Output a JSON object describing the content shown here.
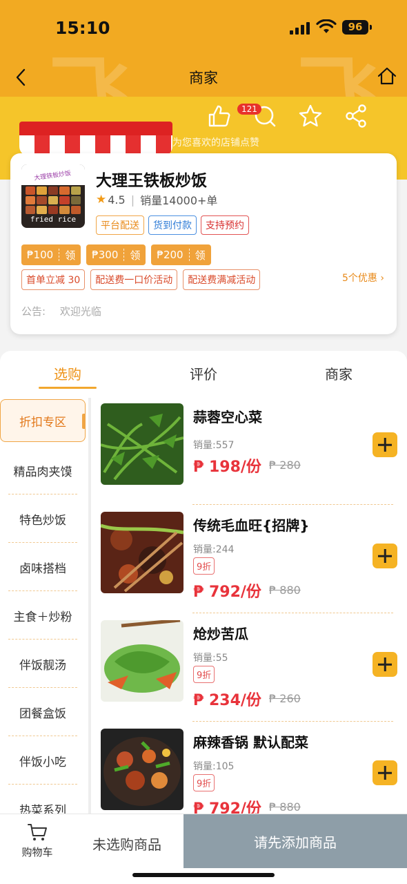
{
  "status_bar": {
    "time": "15:10",
    "battery": "96"
  },
  "nav": {
    "title": "商家"
  },
  "banner": {
    "like_count": "121",
    "tip": "为您喜欢的店铺点赞"
  },
  "shop": {
    "name": "大理王铁板炒饭",
    "logo_band": "大理铁板炒饭",
    "logo_text": "fried rice",
    "rating": "4.5",
    "sales": "销量14000+单",
    "tags": [
      {
        "label": "平台配送",
        "color": "orange"
      },
      {
        "label": "货到付款",
        "color": "blue"
      },
      {
        "label": "支持预约",
        "color": "red"
      }
    ],
    "coupons": [
      {
        "amount": "₱100",
        "action": "领"
      },
      {
        "amount": "₱300",
        "action": "领"
      },
      {
        "amount": "₱200",
        "action": "领"
      }
    ],
    "promos": [
      "首单立减 30",
      "配送费一口价活动",
      "配送费满减活动"
    ],
    "promo_more": "5个优惠",
    "notice_label": "公告:",
    "notice_text": "欢迎光临"
  },
  "tabs": [
    "选购",
    "评价",
    "商家"
  ],
  "active_tab": 0,
  "sidebar": {
    "items": [
      "折扣专区",
      "精品肉夹馍",
      "特色炒饭",
      "卤味搭档",
      "主食＋炒粉",
      "伴饭靓汤",
      "团餐盒饭",
      "伴饭小吃",
      "热菜系列"
    ],
    "active": 0
  },
  "products": [
    {
      "name": "蒜蓉空心菜",
      "sales": "销量:557",
      "discount": "",
      "price": "₱ 198/份",
      "original": "₱ 280"
    },
    {
      "name": "传统毛血旺{招牌}",
      "sales": "销量:244",
      "discount": "9折",
      "price": "₱ 792/份",
      "original": "₱ 880"
    },
    {
      "name": "炝炒苦瓜",
      "sales": "销量:55",
      "discount": "9折",
      "price": "₱ 234/份",
      "original": "₱ 260"
    },
    {
      "name": "麻辣香锅 默认配菜",
      "sales": "销量:105",
      "discount": "9折",
      "price": "₱ 792/份",
      "original": "₱ 880"
    }
  ],
  "bottom": {
    "cart_label": "购物车",
    "empty_text": "未选购商品",
    "checkout": "请先添加商品"
  },
  "colors": {
    "accent": "#f2aa22",
    "price": "#e8333b",
    "checkout": "#8e9ea8"
  }
}
